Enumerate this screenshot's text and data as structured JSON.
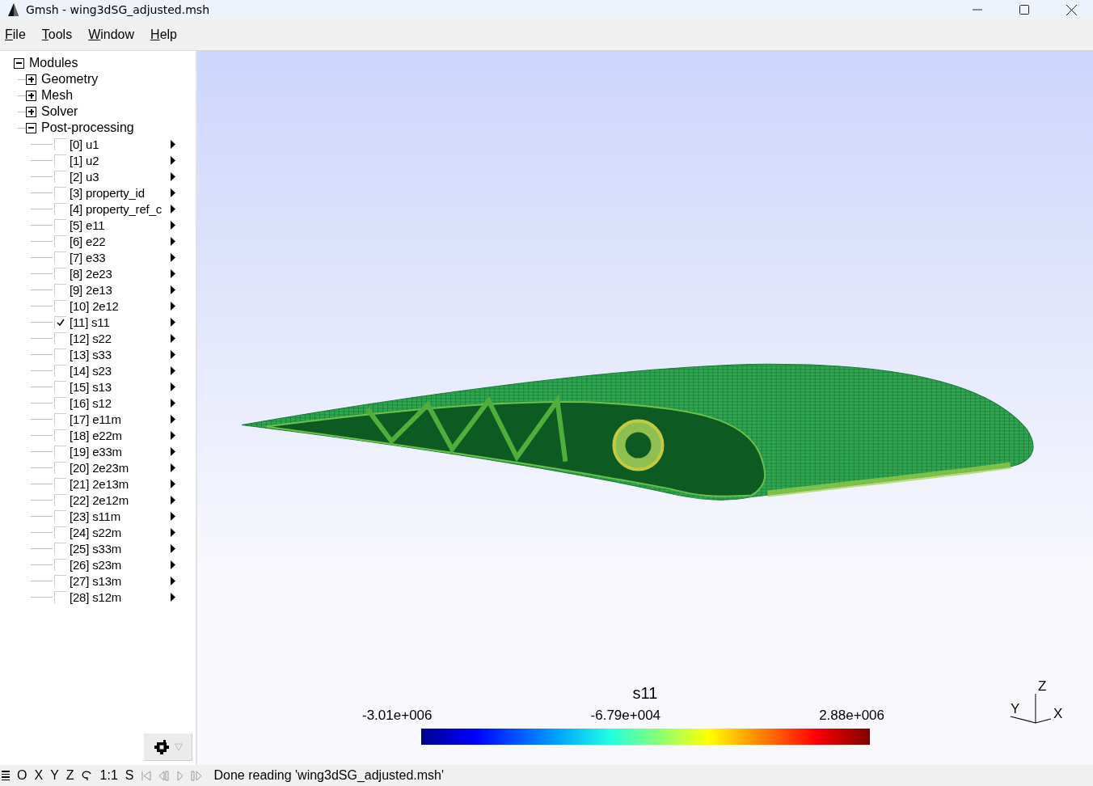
{
  "window": {
    "title": "Gmsh - wing3dSG_adjusted.msh"
  },
  "menu": [
    "File",
    "Tools",
    "Window",
    "Help"
  ],
  "tree": {
    "label": "Modules",
    "expanded": true,
    "children": [
      {
        "label": "Geometry",
        "expanded": false
      },
      {
        "label": "Mesh",
        "expanded": false
      },
      {
        "label": "Solver",
        "expanded": false
      },
      {
        "label": "Post-processing",
        "expanded": true,
        "views": [
          {
            "label": "[0] u1",
            "checked": false
          },
          {
            "label": "[1] u2",
            "checked": false
          },
          {
            "label": "[2] u3",
            "checked": false
          },
          {
            "label": "[3] property_id",
            "checked": false
          },
          {
            "label": "[4] property_ref_c",
            "checked": false
          },
          {
            "label": "[5] e11",
            "checked": false
          },
          {
            "label": "[6] e22",
            "checked": false
          },
          {
            "label": "[7] e33",
            "checked": false
          },
          {
            "label": "[8] 2e23",
            "checked": false
          },
          {
            "label": "[9] 2e13",
            "checked": false
          },
          {
            "label": "[10] 2e12",
            "checked": false
          },
          {
            "label": "[11] s11",
            "checked": true
          },
          {
            "label": "[12] s22",
            "checked": false
          },
          {
            "label": "[13] s33",
            "checked": false
          },
          {
            "label": "[14] s23",
            "checked": false
          },
          {
            "label": "[15] s13",
            "checked": false
          },
          {
            "label": "[16] s12",
            "checked": false
          },
          {
            "label": "[17] e11m",
            "checked": false
          },
          {
            "label": "[18] e22m",
            "checked": false
          },
          {
            "label": "[19] e33m",
            "checked": false
          },
          {
            "label": "[20] 2e23m",
            "checked": false
          },
          {
            "label": "[21] 2e13m",
            "checked": false
          },
          {
            "label": "[22] 2e12m",
            "checked": false
          },
          {
            "label": "[23] s11m",
            "checked": false
          },
          {
            "label": "[24] s22m",
            "checked": false
          },
          {
            "label": "[25] s33m",
            "checked": false
          },
          {
            "label": "[26] s23m",
            "checked": false
          },
          {
            "label": "[27] s13m",
            "checked": false
          },
          {
            "label": "[28] s12m",
            "checked": false
          }
        ]
      }
    ]
  },
  "colorbar": {
    "title": "s11",
    "labels": [
      "-3.01e+006",
      "-6.79e+004",
      "2.88e+006"
    ]
  },
  "axes": {
    "z": "Z",
    "y": "Y",
    "x": "X"
  },
  "status_bar": {
    "buttons": [
      "O",
      "X",
      "Y",
      "Z"
    ],
    "scale": "1:1",
    "s": "S",
    "message": "Done reading 'wing3dSG_adjusted.msh'"
  }
}
